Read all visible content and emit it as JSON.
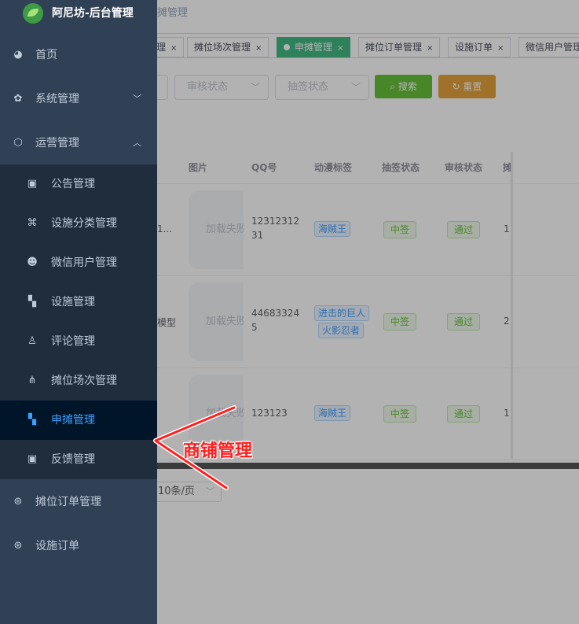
{
  "brand": {
    "title": "阿尼坊-后台管理"
  },
  "breadcrumb": "摊管理",
  "tabs": [
    {
      "label": "理"
    },
    {
      "label": "摊位场次管理"
    },
    {
      "label": "申摊管理"
    },
    {
      "label": "摊位订单管理"
    },
    {
      "label": "设施订单"
    },
    {
      "label": "微信用户管理"
    }
  ],
  "tab_close": "×",
  "filters": {
    "audit_status": "审核状态",
    "draw_status": "抽签状态",
    "search": "搜索",
    "reset": "重置"
  },
  "table": {
    "headers": [
      "图片",
      "QQ号",
      "动漫标签",
      "抽签状态",
      "审核状态",
      "摊"
    ],
    "img_failed": "加载失败",
    "rows": [
      {
        "name_fragment": "1...",
        "qq_line1": "12312312",
        "qq_line2": "31",
        "tags": [
          "海贼王"
        ],
        "draw": "中签",
        "audit": "通过",
        "extra": "1"
      },
      {
        "name_fragment": "模型",
        "qq_line1": "44683324",
        "qq_line2": "5",
        "tags": [
          "进击的巨人",
          "火影忍者"
        ],
        "draw": "中签",
        "audit": "通过",
        "extra": "2"
      },
      {
        "name_fragment": "",
        "qq_line1": "123123",
        "qq_line2": "",
        "tags": [
          "海贼王"
        ],
        "draw": "中签",
        "audit": "通过",
        "extra": "1"
      }
    ]
  },
  "pagination": {
    "page_size": "10条/页"
  },
  "sidebar": {
    "top_items": [
      {
        "label": "首页",
        "icon": "dashboard-icon"
      },
      {
        "label": "系统管理",
        "icon": "gear-icon"
      },
      {
        "label": "运营管理",
        "icon": "cube-icon"
      }
    ],
    "sub_items": [
      {
        "label": "公告管理",
        "icon": "message-icon"
      },
      {
        "label": "设施分类管理",
        "icon": "grid-circles-icon"
      },
      {
        "label": "微信用户管理",
        "icon": "wechat-icon"
      },
      {
        "label": "设施管理",
        "icon": "grid-icon"
      },
      {
        "label": "评论管理",
        "icon": "user-icon"
      },
      {
        "label": "摊位场次管理",
        "icon": "tree-icon"
      },
      {
        "label": "申摊管理",
        "icon": "grid-icon",
        "active": true
      },
      {
        "label": "反馈管理",
        "icon": "message-icon"
      }
    ],
    "bottom_items": [
      {
        "label": "摊位订单管理",
        "icon": "order-icon"
      },
      {
        "label": "设施订单",
        "icon": "order-icon"
      }
    ]
  },
  "annotation": {
    "text": "商铺管理",
    "color": "#ff1e1e"
  },
  "colors": {
    "sidebar_bg": "#304156",
    "submenu_bg": "#1f2d3d",
    "active_text": "#409eff",
    "tab_active": "#42b983"
  }
}
